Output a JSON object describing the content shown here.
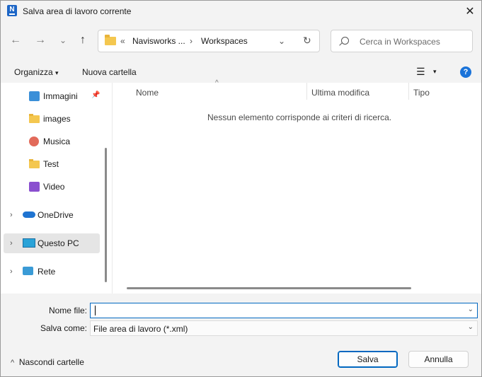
{
  "window": {
    "title": "Salva area di lavoro corrente",
    "app_icon_letter": "N",
    "close_glyph": "✕"
  },
  "nav_buttons": {
    "back": "←",
    "forward": "→",
    "recent": "⌄",
    "up": "↑"
  },
  "address": {
    "overflow": "«",
    "parent": "Navisworks ...",
    "separator": "›",
    "current": "Workspaces",
    "dropdown": "⌄",
    "refresh": "↻"
  },
  "search": {
    "placeholder": "Cerca in Workspaces"
  },
  "toolbar": {
    "organize": "Organizza",
    "organize_caret": "▾",
    "new_folder": "Nuova cartella",
    "view_icon": "☰",
    "view_caret": "▾",
    "help": "?"
  },
  "nav_pane": {
    "items": [
      {
        "label": "Immagini",
        "pin": "📌"
      },
      {
        "label": "images"
      },
      {
        "label": "Musica"
      },
      {
        "label": "Test"
      },
      {
        "label": "Video"
      },
      {
        "label": "OneDrive",
        "chevron": "›"
      },
      {
        "label": "Questo PC",
        "chevron": "›"
      },
      {
        "label": "Rete",
        "chevron": "›"
      }
    ]
  },
  "columns": {
    "name": "Nome",
    "modified": "Ultima modifica",
    "type": "Tipo",
    "sort_glyph": "^"
  },
  "empty_message": "Nessun elemento corrisponde ai criteri di ricerca.",
  "form": {
    "filename_label": "Nome file:",
    "filename_value": "",
    "savetype_label": "Salva come:",
    "savetype_value": "File area di lavoro (*.xml)",
    "dropdown_glyph": "⌄"
  },
  "footer": {
    "hide_folders_glyph": "^",
    "hide_folders": "Nascondi cartelle",
    "save": "Salva",
    "cancel": "Annulla"
  },
  "colors": {
    "accent": "#0067c0",
    "help_blue": "#1a73d9",
    "folder": "#f4c74f"
  }
}
